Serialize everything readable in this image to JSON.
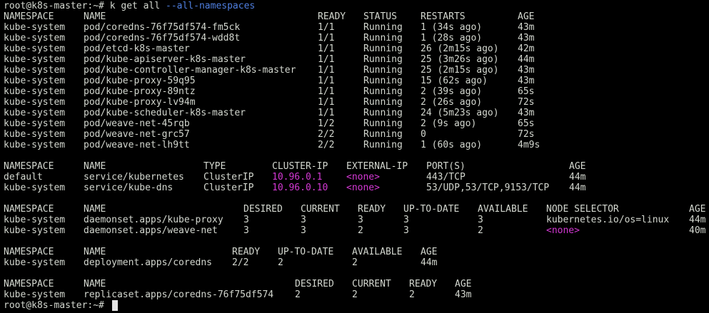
{
  "prompt": {
    "user_host": "root@k8s-master:~#",
    "command": "k get all",
    "flag": "--all-namespaces"
  },
  "pods": {
    "headers": [
      "NAMESPACE",
      "NAME",
      "READY",
      "STATUS",
      "RESTARTS",
      "AGE"
    ],
    "rows": [
      [
        "kube-system",
        "pod/coredns-76f75df574-fm5ck",
        "1/1",
        "Running",
        "1 (34s ago)",
        "43m"
      ],
      [
        "kube-system",
        "pod/coredns-76f75df574-wdd8t",
        "1/1",
        "Running",
        "1 (28s ago)",
        "43m"
      ],
      [
        "kube-system",
        "pod/etcd-k8s-master",
        "1/1",
        "Running",
        "26 (2m15s ago)",
        "42m"
      ],
      [
        "kube-system",
        "pod/kube-apiserver-k8s-master",
        "1/1",
        "Running",
        "25 (3m26s ago)",
        "44m"
      ],
      [
        "kube-system",
        "pod/kube-controller-manager-k8s-master",
        "1/1",
        "Running",
        "25 (2m15s ago)",
        "43m"
      ],
      [
        "kube-system",
        "pod/kube-proxy-59q95",
        "1/1",
        "Running",
        "15 (62s ago)",
        "43m"
      ],
      [
        "kube-system",
        "pod/kube-proxy-89ntz",
        "1/1",
        "Running",
        "2 (39s ago)",
        "65s"
      ],
      [
        "kube-system",
        "pod/kube-proxy-lv94m",
        "1/1",
        "Running",
        "2 (26s ago)",
        "72s"
      ],
      [
        "kube-system",
        "pod/kube-scheduler-k8s-master",
        "1/1",
        "Running",
        "24 (5m23s ago)",
        "43m"
      ],
      [
        "kube-system",
        "pod/weave-net-45rqb",
        "1/2",
        "Running",
        "2 (9s ago)",
        "65s"
      ],
      [
        "kube-system",
        "pod/weave-net-grc57",
        "2/2",
        "Running",
        "0",
        "72s"
      ],
      [
        "kube-system",
        "pod/weave-net-lh9tt",
        "2/2",
        "Running",
        "1 (60s ago)",
        "4m9s"
      ]
    ]
  },
  "services": {
    "headers": [
      "NAMESPACE",
      "NAME",
      "TYPE",
      "CLUSTER-IP",
      "EXTERNAL-IP",
      "PORT(S)",
      "AGE"
    ],
    "rows": [
      [
        "default",
        "service/kubernetes",
        "ClusterIP",
        "10.96.0.1",
        "<none>",
        "443/TCP",
        "44m"
      ],
      [
        "kube-system",
        "service/kube-dns",
        "ClusterIP",
        "10.96.0.10",
        "<none>",
        "53/UDP,53/TCP,9153/TCP",
        "44m"
      ]
    ]
  },
  "daemonsets": {
    "headers": [
      "NAMESPACE",
      "NAME",
      "DESIRED",
      "CURRENT",
      "READY",
      "UP-TO-DATE",
      "AVAILABLE",
      "NODE SELECTOR",
      "AGE"
    ],
    "rows": [
      [
        "kube-system",
        "daemonset.apps/kube-proxy",
        "3",
        "3",
        "3",
        "3",
        "3",
        "kubernetes.io/os=linux",
        "44m"
      ],
      [
        "kube-system",
        "daemonset.apps/weave-net",
        "3",
        "3",
        "2",
        "3",
        "2",
        "<none>",
        "40m"
      ]
    ]
  },
  "deployments": {
    "headers": [
      "NAMESPACE",
      "NAME",
      "READY",
      "UP-TO-DATE",
      "AVAILABLE",
      "AGE"
    ],
    "rows": [
      [
        "kube-system",
        "deployment.apps/coredns",
        "2/2",
        "2",
        "2",
        "44m"
      ]
    ]
  },
  "replicasets": {
    "headers": [
      "NAMESPACE",
      "NAME",
      "DESIRED",
      "CURRENT",
      "READY",
      "AGE"
    ],
    "rows": [
      [
        "kube-system",
        "replicaset.apps/coredns-76f75df574",
        "2",
        "2",
        "2",
        "43m"
      ]
    ]
  },
  "final_prompt": "root@k8s-master:~#",
  "colors": {
    "background": "#000000",
    "text": "#d3d7cf",
    "highlight": "#d338d3",
    "flag": "#4f7fe0",
    "cursor": "#e6e6e6"
  }
}
